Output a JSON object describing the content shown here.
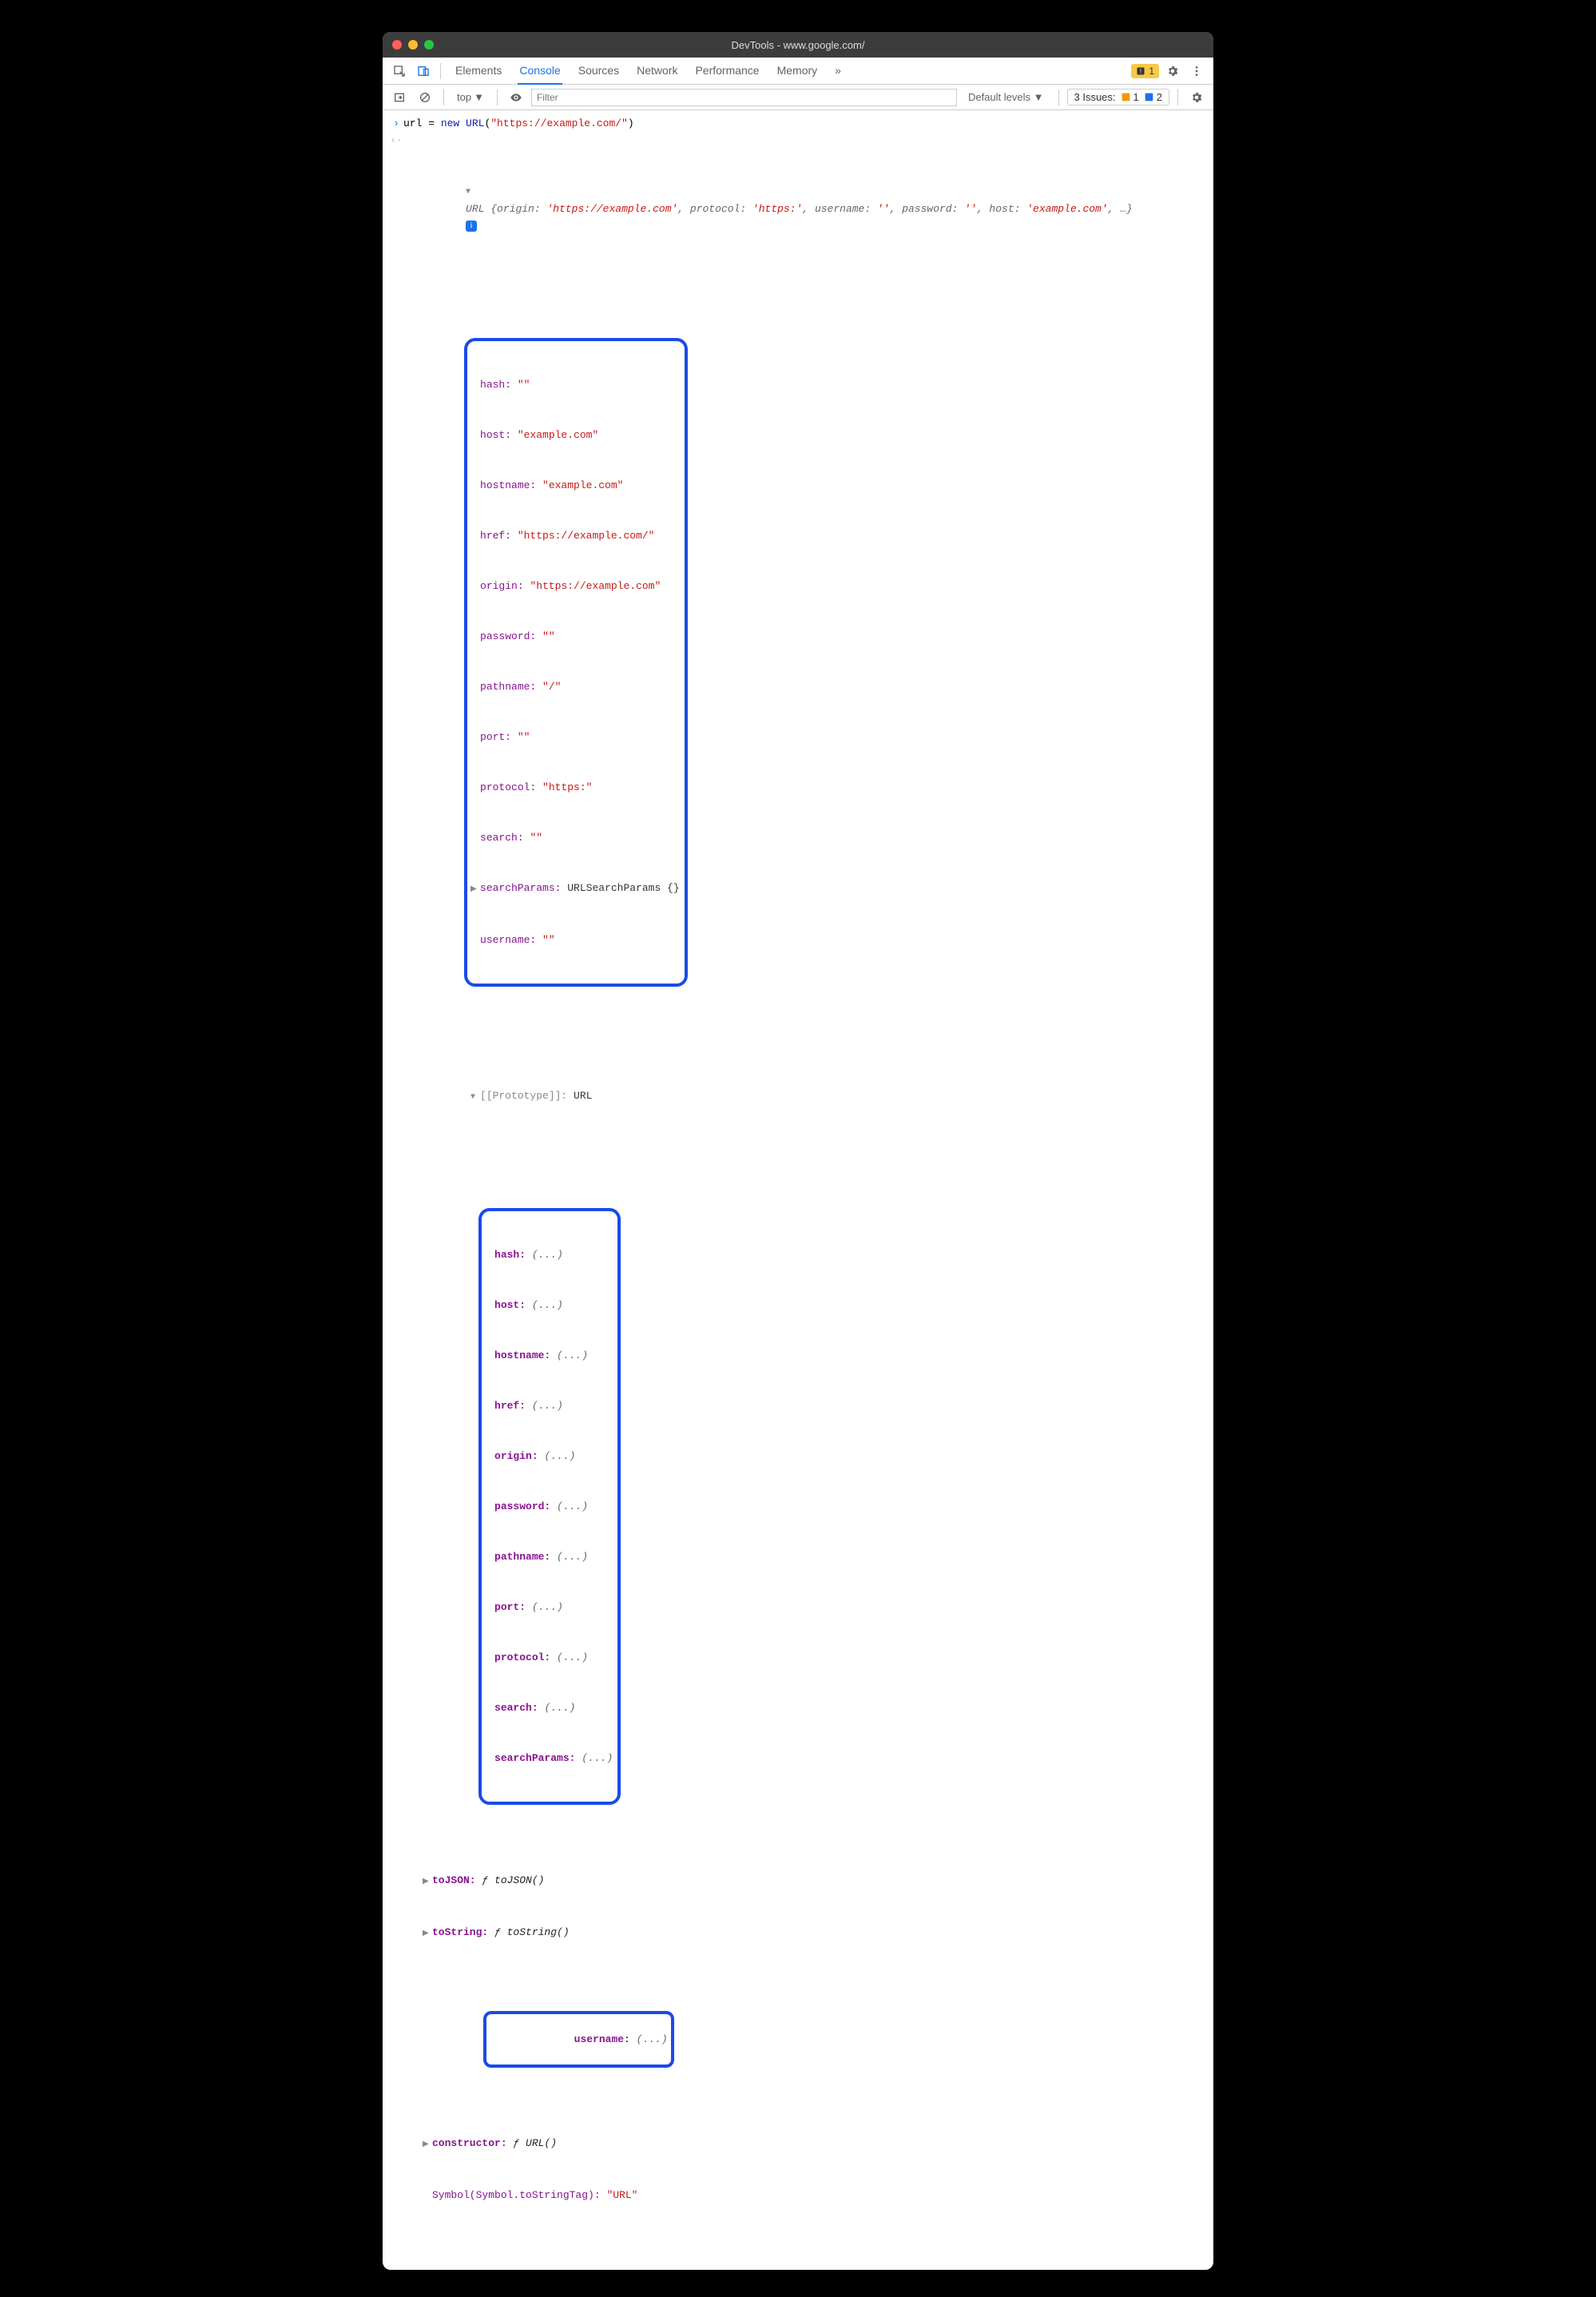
{
  "window": {
    "title": "DevTools - www.google.com/"
  },
  "tabs": {
    "elements": "Elements",
    "console": "Console",
    "sources": "Sources",
    "network": "Network",
    "performance": "Performance",
    "memory": "Memory"
  },
  "badge_count": "1",
  "toolbar": {
    "context": "top",
    "filter_placeholder": "Filter",
    "levels": "Default levels",
    "issues_label": "3 Issues:",
    "issues_warn": "1",
    "issues_info": "2"
  },
  "input": {
    "expr": "url = ",
    "kw_new": "new",
    "cls": "URL",
    "paren_open": "(",
    "arg": "\"https://example.com/\"",
    "paren_close": ")"
  },
  "summary": {
    "class": "URL ",
    "open": "{",
    "k_origin": "origin: ",
    "v_origin": "'https://example.com'",
    "k_protocol": "protocol: ",
    "v_protocol": "'https:'",
    "k_username": "username: ",
    "v_username": "''",
    "k_password": "password: ",
    "v_password": "''",
    "k_host": "host: ",
    "v_host": "'example.com'",
    "tail": ", …}"
  },
  "props": {
    "hash_k": "hash: ",
    "hash_v": "\"\"",
    "host_k": "host: ",
    "host_v": "\"example.com\"",
    "hostname_k": "hostname: ",
    "hostname_v": "\"example.com\"",
    "href_k": "href: ",
    "href_v": "\"https://example.com/\"",
    "origin_k": "origin: ",
    "origin_v": "\"https://example.com\"",
    "password_k": "password: ",
    "password_v": "\"\"",
    "pathname_k": "pathname: ",
    "pathname_v": "\"/\"",
    "port_k": "port: ",
    "port_v": "\"\"",
    "protocol_k": "protocol: ",
    "protocol_v": "\"https:\"",
    "search_k": "search: ",
    "search_v": "\"\"",
    "searchParams_k": "searchParams: ",
    "searchParams_v": "URLSearchParams {}",
    "username_k": "username: ",
    "username_v": "\"\""
  },
  "proto": {
    "label_k": "[[Prototype]]: ",
    "label_v": "URL",
    "hash": "hash: ",
    "host": "host: ",
    "hostname": "hostname: ",
    "href": "href: ",
    "origin": "origin: ",
    "password": "password: ",
    "pathname": "pathname: ",
    "port": "port: ",
    "protocol": "protocol: ",
    "search": "search: ",
    "searchParams": "searchParams: ",
    "ellipsis": "(...)",
    "toJSON_k": "toJSON: ",
    "toJSON_v": "ƒ toJSON()",
    "toString_k": "toString: ",
    "toString_v": "ƒ toString()",
    "username_k": "username: ",
    "constructor_k": "constructor: ",
    "constructor_v": "ƒ URL()",
    "symbol_k": "Symbol(Symbol.toStringTag): ",
    "symbol_v": "\"URL\""
  }
}
